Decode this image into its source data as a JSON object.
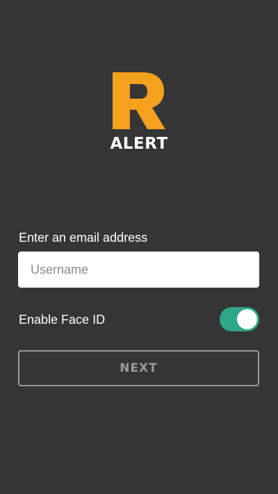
{
  "logo": {
    "letter": "R",
    "word": "ALERT",
    "accent_color": "#f4a11e"
  },
  "login": {
    "email_label": "Enter an email address",
    "email_value": "",
    "email_placeholder": "Username",
    "faceid_label": "Enable Face ID",
    "faceid_enabled": true,
    "toggle_color": "#2fa58a",
    "next_label": "NEXT"
  }
}
